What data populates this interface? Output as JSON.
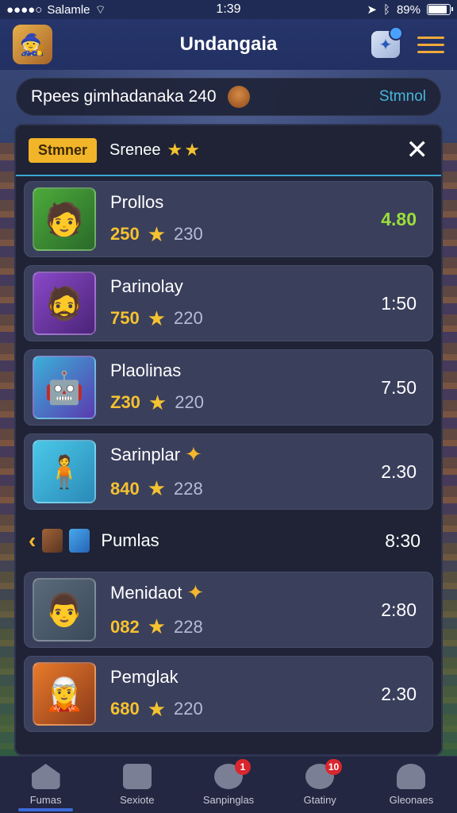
{
  "status_bar": {
    "carrier": "Salamle",
    "time": "1:39",
    "battery": "89%",
    "battery_level": 0.89
  },
  "header": {
    "title": "Undangaia"
  },
  "banner": {
    "text": "Rpees gimhadanaka 240",
    "link": "Stmnol"
  },
  "panel": {
    "tag": "Stmner",
    "title": "Srenee",
    "stars": "★★",
    "close": "✕"
  },
  "players": [
    {
      "name": "Prollos",
      "value_a": "250",
      "value_b": "230",
      "score": "4.80"
    },
    {
      "name": "Parinolay",
      "value_a": "750",
      "value_b": "220",
      "score": "1:50"
    },
    {
      "name": "Plaolinas",
      "value_a": "Z30",
      "value_b": "220",
      "score": "7.50"
    },
    {
      "name": "Sarinplar",
      "value_a": "840",
      "value_b": "228",
      "score": "2.30"
    }
  ],
  "section": {
    "label": "Pumlas",
    "value": "8:30"
  },
  "players2": [
    {
      "name": "Menidaot",
      "value_a": "082",
      "value_b": "228",
      "score": "2:80"
    },
    {
      "name": "Pemglak",
      "value_a": "680",
      "value_b": "220",
      "score": "2.30"
    }
  ],
  "nav": [
    {
      "label": "Fumas"
    },
    {
      "label": "Sexiote"
    },
    {
      "label": "Sanpinglas",
      "badge": "1"
    },
    {
      "label": "Gtatiny",
      "badge": "10"
    },
    {
      "label": "Gleonaes"
    }
  ],
  "colors": {
    "accent_gold": "#f5c230",
    "tag_bg": "#f2b428",
    "score_green": "#9adf3a",
    "link_blue": "#46b6d8",
    "badge_red": "#d9262e"
  }
}
